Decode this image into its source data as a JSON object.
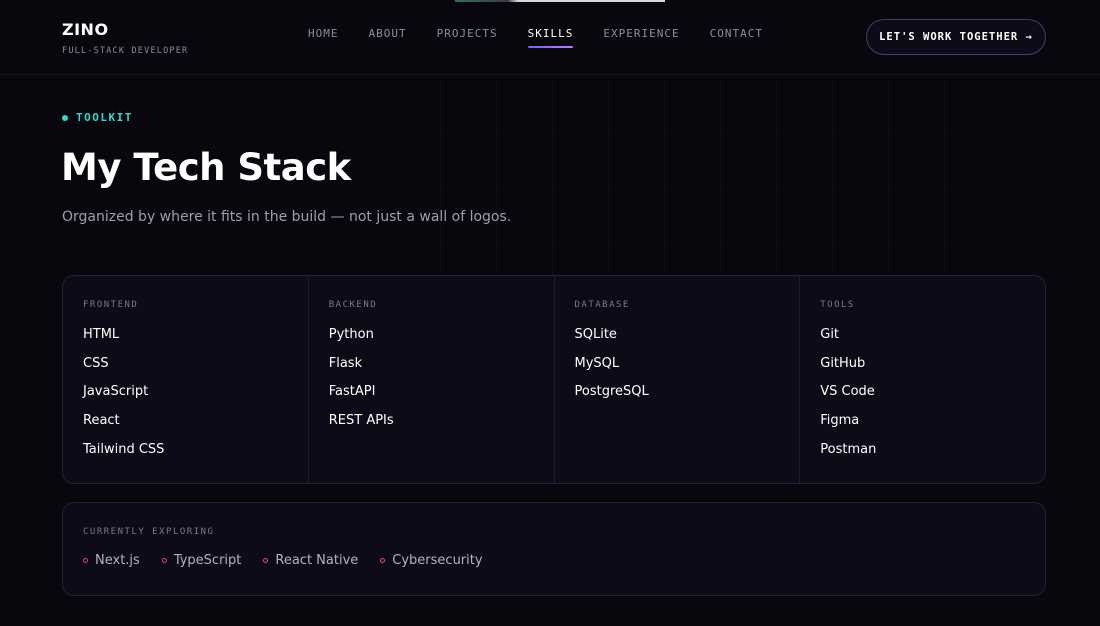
{
  "brand": {
    "name": "ZINO",
    "subtitle": "FULL-STACK DEVELOPER"
  },
  "nav": {
    "items": [
      {
        "label": "HOME",
        "active": false
      },
      {
        "label": "ABOUT",
        "active": false
      },
      {
        "label": "PROJECTS",
        "active": false
      },
      {
        "label": "SKILLS",
        "active": true
      },
      {
        "label": "EXPERIENCE",
        "active": false
      },
      {
        "label": "CONTACT",
        "active": false
      }
    ],
    "cta_label": "LET'S WORK TOGETHER →"
  },
  "hero": {
    "eyebrow": "TOOLKIT",
    "title": "My Tech Stack",
    "subtitle": "Organized by where it fits in the build — not just a wall of logos."
  },
  "stack": {
    "columns": [
      {
        "heading": "FRONTEND",
        "items": [
          "HTML",
          "CSS",
          "JavaScript",
          "React",
          "Tailwind CSS"
        ]
      },
      {
        "heading": "BACKEND",
        "items": [
          "Python",
          "Flask",
          "FastAPI",
          "REST APIs"
        ]
      },
      {
        "heading": "DATABASE",
        "items": [
          "SQLite",
          "MySQL",
          "PostgreSQL"
        ]
      },
      {
        "heading": "TOOLS",
        "items": [
          "Git",
          "GitHub",
          "VS Code",
          "Figma",
          "Postman"
        ]
      }
    ]
  },
  "exploring": {
    "heading": "CURRENTLY EXPLORING",
    "items": [
      "Next.js",
      "TypeScript",
      "React Native",
      "Cybersecurity"
    ]
  },
  "colors": {
    "accent_teal": "#34d8cf",
    "accent_purple": "#7c5cff",
    "accent_pink": "#e0457b",
    "background": "#08070d"
  }
}
